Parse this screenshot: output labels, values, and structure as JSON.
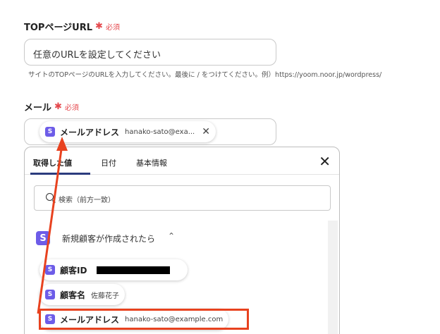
{
  "top_url_field": {
    "label": "TOPページURL",
    "required_mark": "✱",
    "required_text": "必須",
    "placeholder": "任意のURLを設定してください",
    "hint": "サイトのTOPページのURLを入力してください。最後に / をつけてください。例）https://yoom.noor.jp/wordpress/"
  },
  "mail_field": {
    "label": "メール",
    "required_mark": "✱",
    "required_text": "必須",
    "chip": {
      "icon": "S",
      "label": "メールアドレス",
      "value": "hanako-sato@exa...",
      "close": "✕"
    }
  },
  "picker": {
    "tabs": [
      "取得した値",
      "日付",
      "基本情報"
    ],
    "active_tab": 0,
    "close": "✕",
    "search_placeholder": "検索（前方一致）",
    "group": {
      "icon": "S",
      "title": "新規顧客が作成されたら",
      "chevron": "⌃"
    },
    "items": [
      {
        "icon": "S",
        "label": "顧客ID",
        "value": ""
      },
      {
        "icon": "S",
        "label": "顧客名",
        "value": "佐藤花子"
      },
      {
        "icon": "S",
        "label": "メールアドレス",
        "value": "hanako-sato@example.com"
      }
    ]
  },
  "colors": {
    "accent": "#6d5ce8",
    "required": "#e5484d",
    "annotation": "#e8421f",
    "tab_active": "#2b3c7e"
  }
}
